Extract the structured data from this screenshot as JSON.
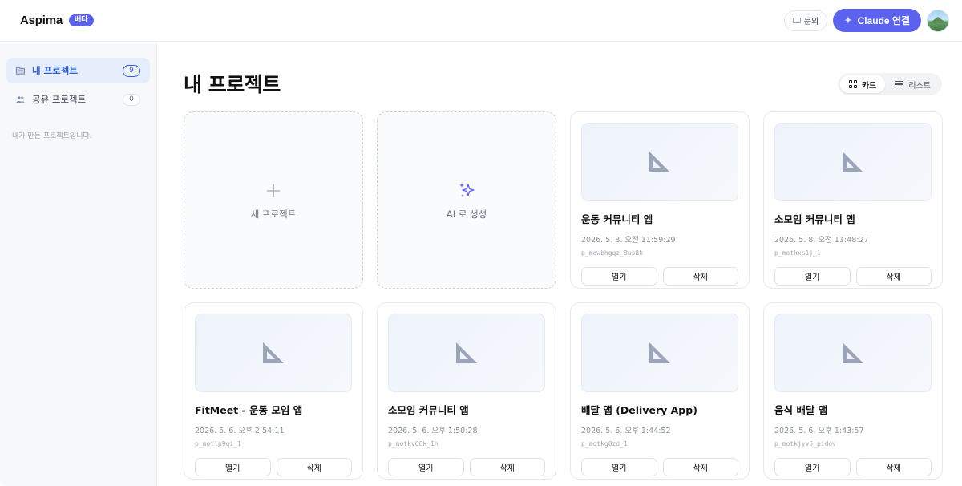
{
  "header": {
    "brand": "Aspima",
    "beta_badge": "베타",
    "inquiry_label": "문의",
    "claude_connect_label": "Claude 연결"
  },
  "sidebar": {
    "items": [
      {
        "label": "내 프로젝트",
        "count": "9",
        "icon": "folder-icon",
        "active": true
      },
      {
        "label": "공유 프로젝트",
        "count": "0",
        "icon": "people-icon",
        "active": false
      }
    ],
    "description": "내가 만든 프로젝트입니다."
  },
  "main": {
    "title": "내 프로젝트",
    "view_toggle": {
      "card_label": "카드",
      "list_label": "리스트",
      "selected": "카드"
    },
    "new_project_label": "새 프로젝트",
    "ai_create_label": "AI 로 생성",
    "open_label": "열기",
    "delete_label": "삭제",
    "projects": [
      {
        "title": "운동 커뮤니티 앱",
        "date": "2026. 5. 8. 오전 11:59:29",
        "id": "p_mowbhgqz_8ws8k"
      },
      {
        "title": "소모임 커뮤니티 앱",
        "date": "2026. 5. 8. 오전 11:48:27",
        "id": "p_motkxs1j_1"
      },
      {
        "title": "FitMeet - 운동 모임 앱",
        "date": "2026. 5. 6. 오후 2:54:11",
        "id": "p_motlp9qi_1"
      },
      {
        "title": "소모임 커뮤니티 앱",
        "date": "2026. 5. 6. 오후 1:50:28",
        "id": "p_motkv66k_1h"
      },
      {
        "title": "배달 앱 (Delivery App)",
        "date": "2026. 5. 6. 오후 1:44:52",
        "id": "p_motkg0zd_1"
      },
      {
        "title": "음식 배달 앱",
        "date": "2026. 5. 6. 오후 1:43:57",
        "id": "p_motkjyv5_pidov"
      }
    ]
  },
  "colors": {
    "accent": "#5b63ee",
    "active_nav": "#2f5fd0",
    "thumb_icon": "#9aa5b8"
  }
}
